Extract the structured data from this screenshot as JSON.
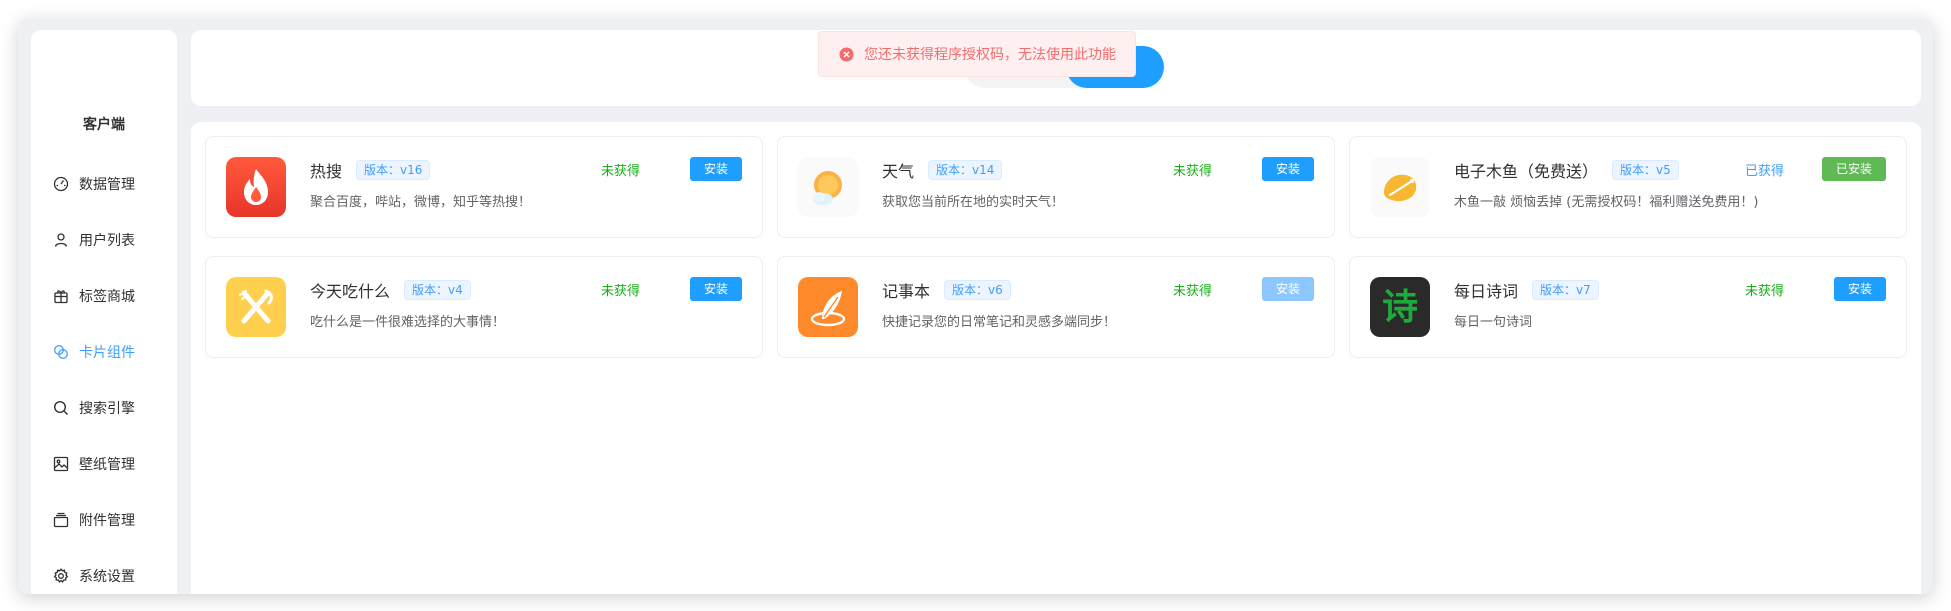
{
  "sidebar": {
    "brand": "客户端",
    "items": [
      {
        "label": "数据管理",
        "icon": "dashboard-icon",
        "active": false
      },
      {
        "label": "用户列表",
        "icon": "user-icon",
        "active": false
      },
      {
        "label": "标签商城",
        "icon": "gift-icon",
        "active": false
      },
      {
        "label": "卡片组件",
        "icon": "components-icon",
        "active": true
      },
      {
        "label": "搜索引擎",
        "icon": "search-icon",
        "active": false
      },
      {
        "label": "壁纸管理",
        "icon": "image-icon",
        "active": false
      },
      {
        "label": "附件管理",
        "icon": "attachment-icon",
        "active": false
      },
      {
        "label": "系统设置",
        "icon": "gear-icon",
        "active": false
      }
    ]
  },
  "toast": {
    "message": "您还未获得程序授权码，无法使用此功能",
    "icon": "error-circle-icon"
  },
  "cards": [
    {
      "name": "热搜",
      "version": "版本：v16",
      "desc": "聚合百度，哔站，微博，知乎等热搜！",
      "status": "未获得",
      "button": "安装",
      "logo": "flame-icon"
    },
    {
      "name": "天气",
      "version": "版本：v14",
      "desc": "获取您当前所在地的实时天气！",
      "status": "未获得",
      "button": "安装",
      "logo": "weather-icon"
    },
    {
      "name": "电子木鱼（免费送）",
      "version": "版本：v5",
      "desc": "木鱼一敲 烦恼丢掉 (无需授权码！福利赠送免费用！)",
      "status": "已获得",
      "button": "已安装",
      "logo": "wooden-fish-icon"
    },
    {
      "name": "今天吃什么",
      "version": "版本：v4",
      "desc": "吃什么是一件很难选择的大事情！",
      "status": "未获得",
      "button": "安装",
      "logo": "fork-knife-icon"
    },
    {
      "name": "记事本",
      "version": "版本：v6",
      "desc": "快捷记录您的日常笔记和灵感多端同步！",
      "status": "未获得",
      "button": "安装",
      "logo": "feather-icon"
    },
    {
      "name": "每日诗词",
      "version": "版本：v7",
      "desc": "每日一句诗词",
      "status": "未获得",
      "button": "安装",
      "logo": "poem-icon",
      "logo_text": "诗"
    }
  ],
  "colors": {
    "primary": "#1e9fff",
    "success_text": "#1aad19",
    "error": "#f56c6c",
    "installed": "#5fb954"
  }
}
